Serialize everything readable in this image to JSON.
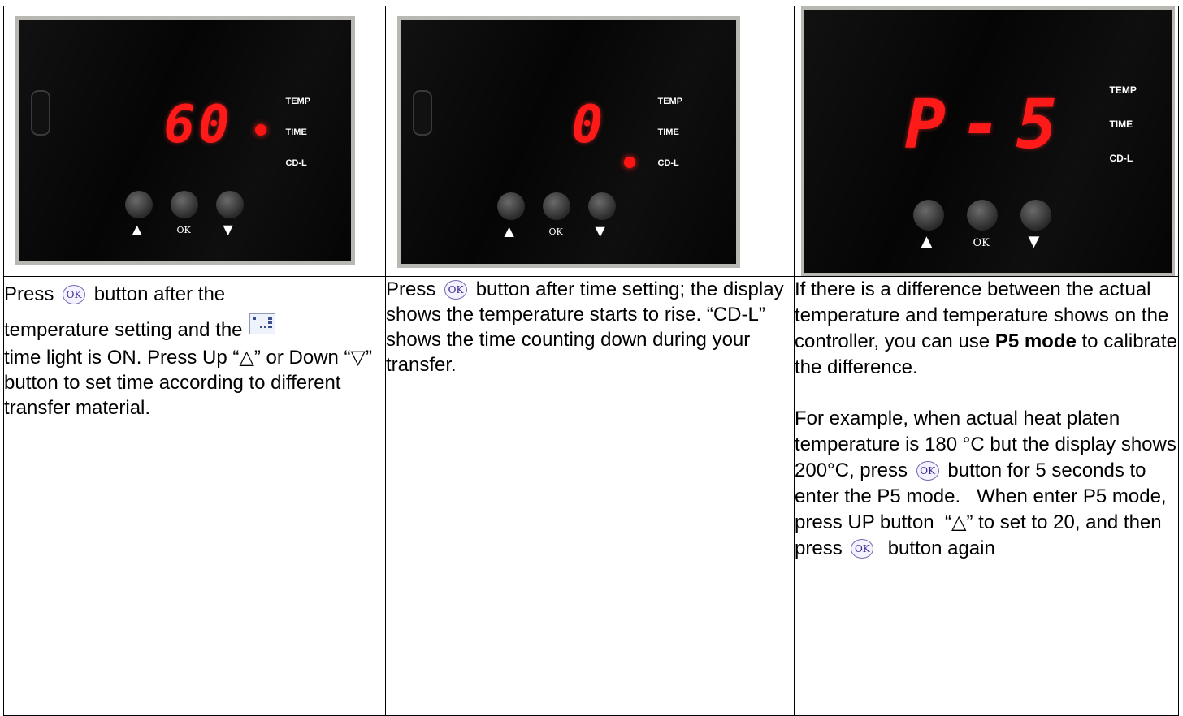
{
  "panels": [
    {
      "display": "60",
      "indicators": [
        "TEMP",
        "TIME",
        "CD-L"
      ],
      "lit_indicator": "TIME",
      "buttons": {
        "up": "▲",
        "ok": "OK",
        "down": "▼"
      }
    },
    {
      "display": "0",
      "indicators": [
        "TEMP",
        "TIME",
        "CD-L"
      ],
      "lit_indicator": "CD-L",
      "buttons": {
        "up": "▲",
        "ok": "OK",
        "down": "▼"
      }
    },
    {
      "display": "P-5",
      "indicators": [
        "TEMP",
        "TIME",
        "CD-L"
      ],
      "lit_indicator": "",
      "buttons": {
        "up": "▲",
        "ok": "OK",
        "down": "▼"
      }
    }
  ],
  "icons": {
    "ok_label": "OK",
    "ok_icon": "ok-button-icon",
    "panel_icon": "control-panel-icon"
  },
  "col1": {
    "part1": "Press",
    "part2": "button after the",
    "part3": "temperature setting and the",
    "part4": "time light is ON. Press Up “△” or Down “▽” button to set time according to different transfer material."
  },
  "col2": {
    "part1": "Press",
    "part2": "button after time setting; the display shows the temperature starts to rise. “CD-L” shows the time counting down during your transfer."
  },
  "col3": {
    "p1_a": "If there is a difference between the actual temperature and temperature shows on the controller, you can use",
    "p1_bold": "P5 mode",
    "p1_b": "to calibrate the difference.",
    "p2_a": "For example, when actual heat platen temperature is 180 °C but the display shows 200°C, press",
    "p2_b": "button for 5 seconds to enter the P5 mode.   When enter P5 mode, press UP button  “△” to set to 20, and then press",
    "p2_c": " button again"
  }
}
